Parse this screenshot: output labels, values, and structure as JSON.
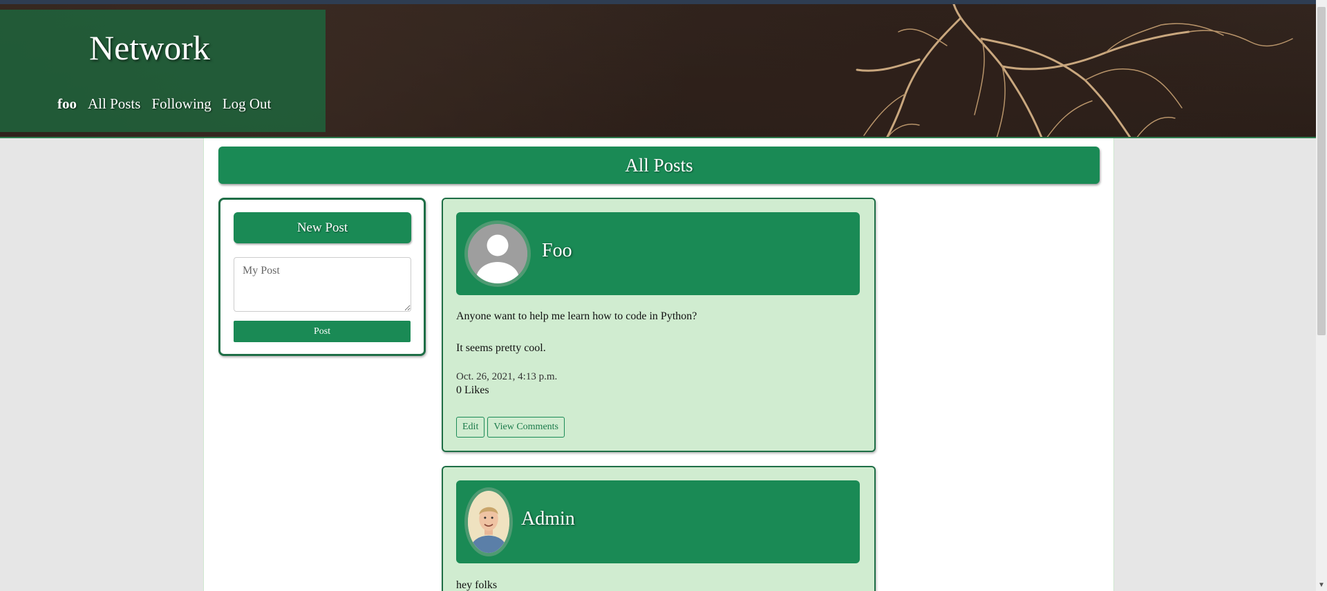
{
  "header": {
    "brand": "Network",
    "nav": [
      {
        "label": "foo"
      },
      {
        "label": "All Posts"
      },
      {
        "label": "Following"
      },
      {
        "label": "Log Out"
      }
    ]
  },
  "page": {
    "title": "All Posts"
  },
  "new_post": {
    "title": "New Post",
    "placeholder": "My Post",
    "button_label": "Post"
  },
  "posts": [
    {
      "author": "Foo",
      "avatar": "default-user-icon",
      "body_lines": [
        "Anyone want to help me learn how to code in Python?",
        "It seems pretty cool."
      ],
      "timestamp": "Oct. 26, 2021, 4:13 p.m.",
      "likes": "0 Likes",
      "actions": [
        "Edit",
        "View Comments"
      ]
    },
    {
      "author": "Admin",
      "avatar": "user-photo",
      "body_lines": [
        "hey folks"
      ]
    }
  ],
  "colors": {
    "primary_green": "#1a8a55",
    "post_bg": "#d0ecd0",
    "page_bg": "#e6e6e6"
  }
}
